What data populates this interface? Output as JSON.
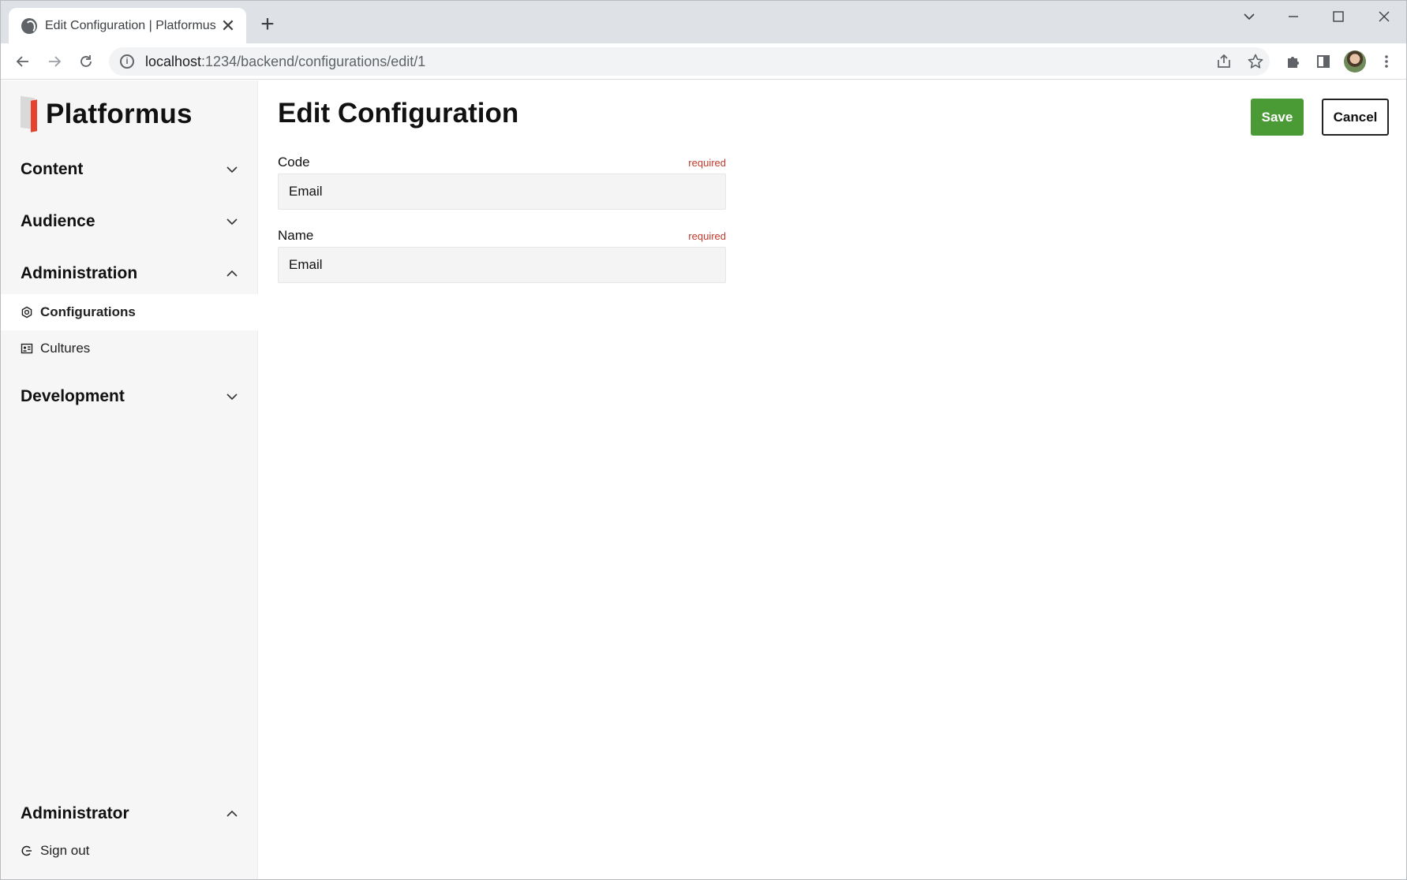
{
  "browser": {
    "tab_title": "Edit Configuration | Platformus",
    "tab_close": "✕",
    "new_tab": "+",
    "url_host": "localhost",
    "url_rest": ":1234/backend/configurations/edit/1",
    "info_glyph": "i"
  },
  "app": {
    "logo_text": "Platformus",
    "colors": {
      "accent": "#e5432e",
      "save": "#4a9a36",
      "required": "#c0392b"
    }
  },
  "sidebar": {
    "sections": [
      {
        "label": "Content",
        "expanded": false
      },
      {
        "label": "Audience",
        "expanded": false
      },
      {
        "label": "Administration",
        "expanded": true
      },
      {
        "label": "Development",
        "expanded": false
      }
    ],
    "admin_items": [
      {
        "label": "Configurations",
        "icon": "gear-icon",
        "active": true
      },
      {
        "label": "Cultures",
        "icon": "id-card-icon",
        "active": false
      }
    ],
    "user": {
      "label": "Administrator",
      "expanded": true,
      "items": [
        {
          "label": "Sign out",
          "icon": "sign-out-icon"
        }
      ]
    }
  },
  "main": {
    "title": "Edit Configuration",
    "save_label": "Save",
    "cancel_label": "Cancel",
    "fields": [
      {
        "label": "Code",
        "required_text": "required",
        "value": "Email"
      },
      {
        "label": "Name",
        "required_text": "required",
        "value": "Email"
      }
    ]
  }
}
